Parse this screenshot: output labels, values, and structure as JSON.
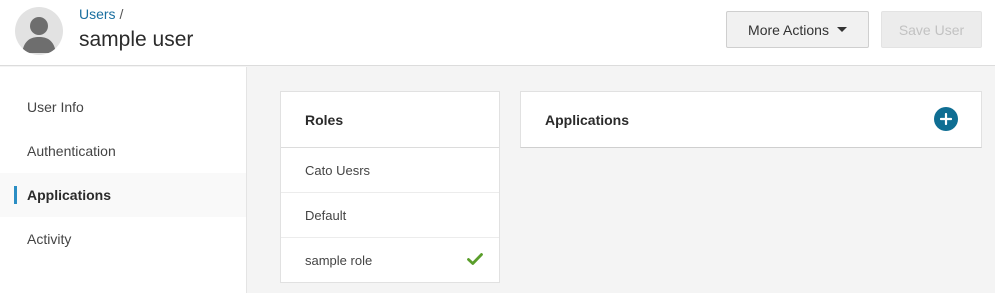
{
  "header": {
    "breadcrumb_link": "Users",
    "breadcrumb_sep": " /",
    "title": "sample user",
    "more_actions_label": "More Actions",
    "save_label": "Save User"
  },
  "sidebar": {
    "items": [
      {
        "label": "User Info",
        "active": false
      },
      {
        "label": "Authentication",
        "active": false
      },
      {
        "label": "Applications",
        "active": true
      },
      {
        "label": "Activity",
        "active": false
      }
    ]
  },
  "roles": {
    "heading": "Roles",
    "items": [
      {
        "label": "Cato Uesrs",
        "selected": false
      },
      {
        "label": "Default",
        "selected": false
      },
      {
        "label": "sample role",
        "selected": true
      }
    ]
  },
  "applications": {
    "heading": "Applications",
    "add_icon": "plus-icon"
  },
  "colors": {
    "accent": "#2b8ec4",
    "link": "#1a6fa0",
    "add_button": "#0f6e93",
    "check": "#5a9e2b"
  }
}
